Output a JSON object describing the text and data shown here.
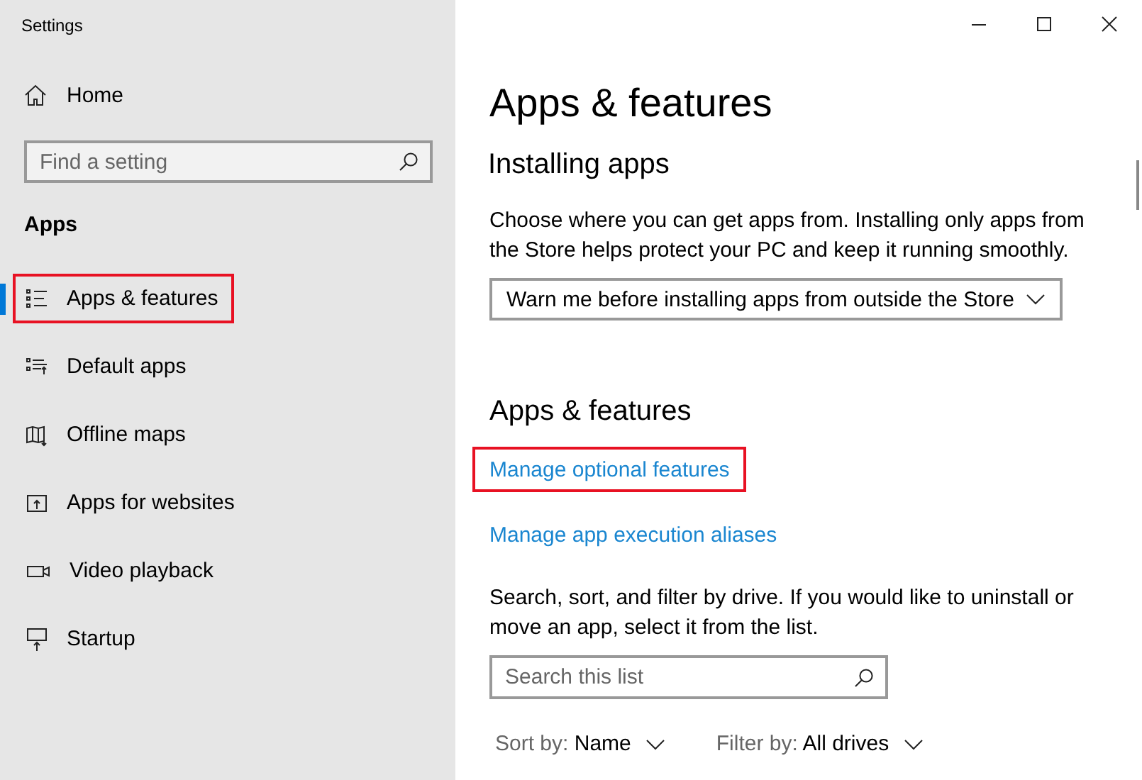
{
  "window": {
    "title": "Settings"
  },
  "sidebar": {
    "home": {
      "label": "Home"
    },
    "search": {
      "placeholder": "Find a setting"
    },
    "section": "Apps",
    "items": [
      {
        "label": "Apps & features",
        "selected": true,
        "highlighted": true
      },
      {
        "label": "Default apps",
        "selected": false,
        "highlighted": false
      },
      {
        "label": "Offline maps",
        "selected": false,
        "highlighted": false
      },
      {
        "label": "Apps for websites",
        "selected": false,
        "highlighted": false
      },
      {
        "label": "Video playback",
        "selected": false,
        "highlighted": false
      },
      {
        "label": "Startup",
        "selected": false,
        "highlighted": false
      }
    ]
  },
  "main": {
    "title": "Apps & features",
    "installing": {
      "heading": "Installing apps",
      "description": "Choose where you can get apps from. Installing only apps from the Store helps protect your PC and keep it running smoothly.",
      "dropdown": "Warn me before installing apps from outside the Store"
    },
    "apps_features": {
      "heading": "Apps & features",
      "links": [
        {
          "label": "Manage optional features",
          "highlighted": true
        },
        {
          "label": "Manage app execution aliases",
          "highlighted": false
        }
      ],
      "description": "Search, sort, and filter by drive. If you would like to uninstall or move an app, select it from the list.",
      "search": {
        "placeholder": "Search this list"
      },
      "sort": {
        "label": "Sort by:",
        "value": "Name"
      },
      "filter": {
        "label": "Filter by:",
        "value": "All drives"
      }
    }
  }
}
